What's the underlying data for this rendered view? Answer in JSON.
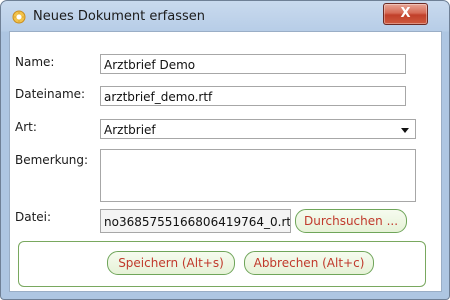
{
  "window": {
    "title": "Neues Dokument erfassen",
    "close_label": "X"
  },
  "labels": {
    "name": "Name:",
    "dateiname": "Dateiname:",
    "art": "Art:",
    "bemerkung": "Bemerkung:",
    "datei": "Datei:"
  },
  "fields": {
    "name_value": "Arztbrief Demo",
    "dateiname_value": "arztbrief_demo.rtf",
    "art_value": "Arztbrief",
    "bemerkung_value": "",
    "datei_value": "no3685755166806419764_0.rtf"
  },
  "buttons": {
    "durchsuchen": "Durchsuchen ...",
    "speichern": "Speichern (Alt+s)",
    "abbrechen": "Abbrechen (Alt+c)"
  },
  "colors": {
    "button_text": "#c0392b",
    "button_border": "#6fa55a",
    "window_frame": "#aec6e2"
  }
}
